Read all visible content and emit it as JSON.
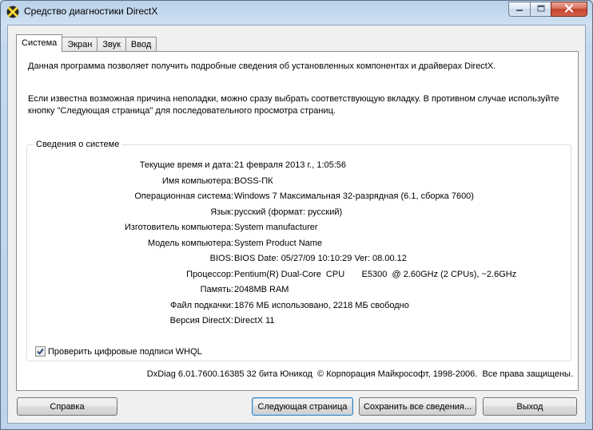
{
  "window": {
    "title": "Средство диагностики DirectX"
  },
  "tabs": [
    {
      "label": "Система",
      "active": true
    },
    {
      "label": "Экран",
      "active": false
    },
    {
      "label": "Звук",
      "active": false
    },
    {
      "label": "Ввод",
      "active": false
    }
  ],
  "intro": {
    "line1": "Данная программа позволяет получить подробные сведения об установленных компонентах и драйверах DirectX.",
    "line2": "Если известна возможная причина неполадки, можно сразу выбрать соответствующую вкладку. В противном случае используйте кнопку \"Следующая страница\" для последовательного просмотра страниц."
  },
  "system_info": {
    "group_title": "Сведения о системе",
    "rows": [
      {
        "label": "Текущие время и дата:",
        "value": "21 февраля 2013 г., 1:05:56"
      },
      {
        "label": "Имя компьютера:",
        "value": "BOSS-ПК"
      },
      {
        "label": "Операционная система:",
        "value": "Windows 7 Максимальная 32-разрядная (6.1, сборка 7600)"
      },
      {
        "label": "Язык:",
        "value": "русский (формат: русский)"
      },
      {
        "label": "Изготовитель компьютера:",
        "value": "System manufacturer"
      },
      {
        "label": "Модель компьютера:",
        "value": "System Product Name"
      },
      {
        "label": "BIOS:",
        "value": "BIOS Date: 05/27/09 10:10:29 Ver: 08.00.12"
      },
      {
        "label": "Процессор:",
        "value": "Pentium(R) Dual-Core  CPU       E5300  @ 2.60GHz (2 CPUs), ~2.6GHz"
      },
      {
        "label": "Память:",
        "value": "2048MB RAM"
      },
      {
        "label": "Файл подкачки:",
        "value": "1876 МБ использовано, 2218 МБ свободно"
      },
      {
        "label": "Версия DirectX:",
        "value": "DirectX 11"
      }
    ],
    "whql_label": "Проверить цифровые подписи WHQL",
    "whql_checked": true
  },
  "footer": {
    "version_text": "DxDiag 6.01.7600.16385 32 бита Юникод  © Корпорация Майкрософт, 1998-2006.  Все права защищены."
  },
  "buttons": {
    "help": "Справка",
    "next": "Следующая страница",
    "save": "Сохранить все сведения...",
    "exit": "Выход"
  },
  "icons": {
    "app": "directx-x-icon",
    "minimize": "minimize-icon",
    "maximize": "maximize-icon",
    "close": "close-icon",
    "check": "checkmark-icon"
  }
}
